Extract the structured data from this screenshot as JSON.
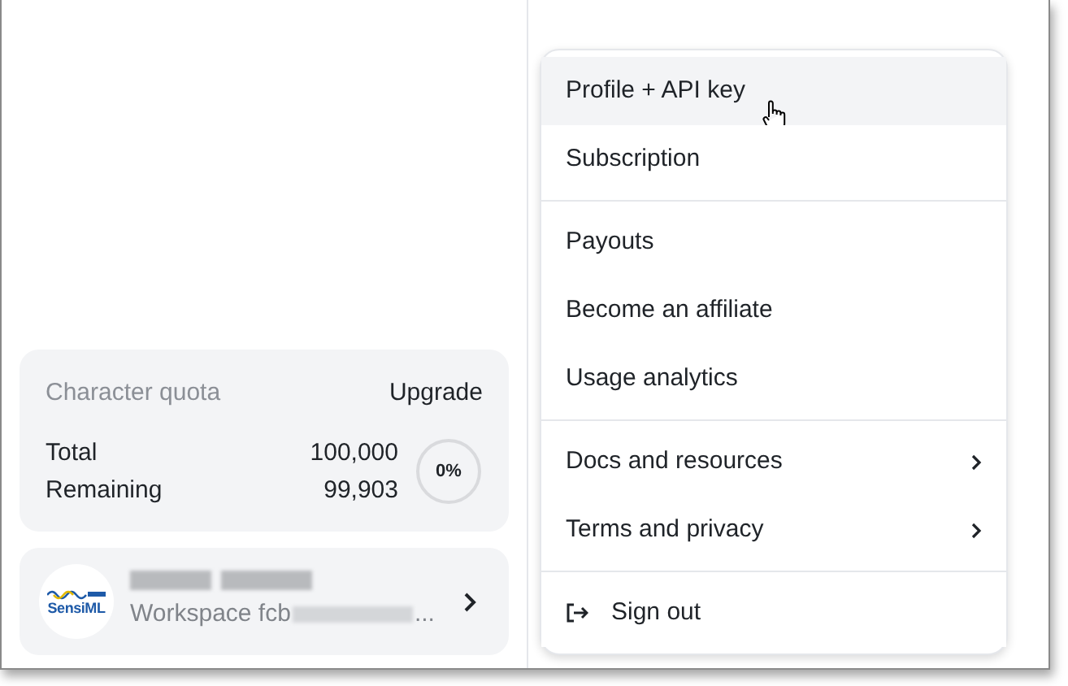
{
  "quota": {
    "title": "Character quota",
    "upgrade": "Upgrade",
    "rows": [
      {
        "label": "Total",
        "value": "100,000"
      },
      {
        "label": "Remaining",
        "value": "99,903"
      }
    ],
    "usage": {
      "text": "0%"
    }
  },
  "account": {
    "logo_text": "SensiML",
    "subtitle": "Workspace fcb",
    "subtitle_end": "..."
  },
  "menu": {
    "groups": [
      [
        {
          "label": "Profile + API key",
          "kind": "item",
          "selected": true
        },
        {
          "label": "Subscription",
          "kind": "item",
          "selected": false
        }
      ],
      [
        {
          "label": "Payouts",
          "kind": "item",
          "selected": false
        },
        {
          "label": "Become an affiliate",
          "kind": "item",
          "selected": false
        },
        {
          "label": "Usage analytics",
          "kind": "item",
          "selected": false
        }
      ],
      [
        {
          "label": "Docs and resources",
          "kind": "submenu",
          "selected": false
        },
        {
          "label": "Terms and privacy",
          "kind": "submenu",
          "selected": false
        }
      ],
      [
        {
          "label": "Sign out",
          "kind": "signout",
          "selected": false
        }
      ]
    ]
  }
}
